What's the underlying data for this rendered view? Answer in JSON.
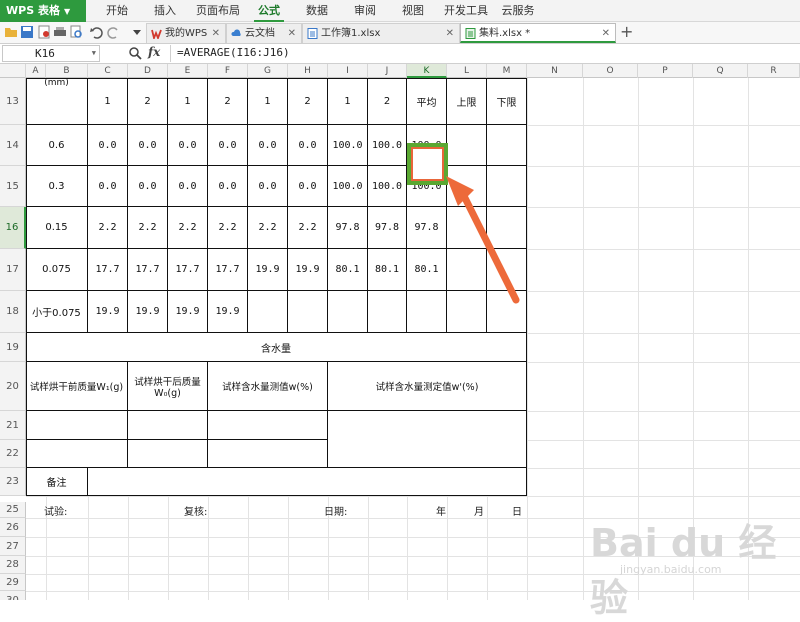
{
  "app": {
    "title": "WPS 表格"
  },
  "menu": [
    {
      "label": "开始"
    },
    {
      "label": "插入"
    },
    {
      "label": "页面布局"
    },
    {
      "label": "公式",
      "active": true
    },
    {
      "label": "数据"
    },
    {
      "label": "审阅"
    },
    {
      "label": "视图"
    },
    {
      "label": "开发工具"
    },
    {
      "label": "云服务"
    }
  ],
  "tabs": [
    {
      "label": "我的WPS",
      "icon": "wps-logo-icon"
    },
    {
      "label": "云文档",
      "icon": "cloud-doc-icon"
    },
    {
      "label": "工作簿1.xlsx",
      "icon": "sheet-doc-icon"
    },
    {
      "label": "集料.xlsx *",
      "icon": "sheet-doc-icon",
      "active": true
    }
  ],
  "formula_bar": {
    "name_box": "K16",
    "fx": "fx",
    "formula": "=AVERAGE(I16:J16)"
  },
  "columns": [
    "A",
    "B",
    "C",
    "D",
    "E",
    "F",
    "G",
    "H",
    "I",
    "J",
    "K",
    "L",
    "M",
    "N",
    "O",
    "P",
    "Q",
    "R"
  ],
  "selected": {
    "column": "K",
    "row": "16"
  },
  "rows": [
    "13",
    "14",
    "15",
    "16",
    "17",
    "18",
    "19",
    "20",
    "21",
    "22",
    "23",
    "25",
    "26",
    "27",
    "28",
    "29",
    "30"
  ],
  "table": {
    "partial_header": "(mm)",
    "header_row": [
      "1",
      "2",
      "1",
      "2",
      "1",
      "2",
      "1",
      "2",
      "平均",
      "上限",
      "下限"
    ],
    "data_rows": [
      {
        "label": "0.6",
        "values": [
          "0.0",
          "0.0",
          "0.0",
          "0.0",
          "0.0",
          "0.0",
          "100.0",
          "100.0",
          "100.0",
          "",
          ""
        ]
      },
      {
        "label": "0.3",
        "values": [
          "0.0",
          "0.0",
          "0.0",
          "0.0",
          "0.0",
          "0.0",
          "100.0",
          "100.0",
          "100.0",
          "",
          ""
        ]
      },
      {
        "label": "0.15",
        "values": [
          "2.2",
          "2.2",
          "2.2",
          "2.2",
          "2.2",
          "2.2",
          "97.8",
          "97.8",
          "97.8",
          "",
          ""
        ]
      },
      {
        "label": "0.075",
        "values": [
          "17.7",
          "17.7",
          "17.7",
          "17.7",
          "19.9",
          "19.9",
          "80.1",
          "80.1",
          "80.1",
          "",
          ""
        ]
      },
      {
        "label": "小于0.075",
        "values": [
          "19.9",
          "19.9",
          "19.9",
          "19.9",
          "",
          "",
          "",
          "",
          "",
          "",
          ""
        ]
      }
    ],
    "moisture_title": "含水量",
    "moisture_headers": {
      "before": "试样烘干前质量W₁(g)",
      "after_line1": "试样烘干后质量",
      "after_line2": "W₀(g)",
      "measured": "试样含水量测值w(%)",
      "determined": "试样含水量测定值w'(%)"
    },
    "remark_label": "备注",
    "footer": {
      "test": "试验:",
      "review": "复核:",
      "date": "日期:",
      "year": "年",
      "month": "月",
      "day": "日"
    }
  },
  "watermark": {
    "main": "Bai du 经验",
    "sub": "jingyan.baidu.com"
  },
  "colors": {
    "accent": "#2e9a3e",
    "highlight": "#e8663a"
  }
}
